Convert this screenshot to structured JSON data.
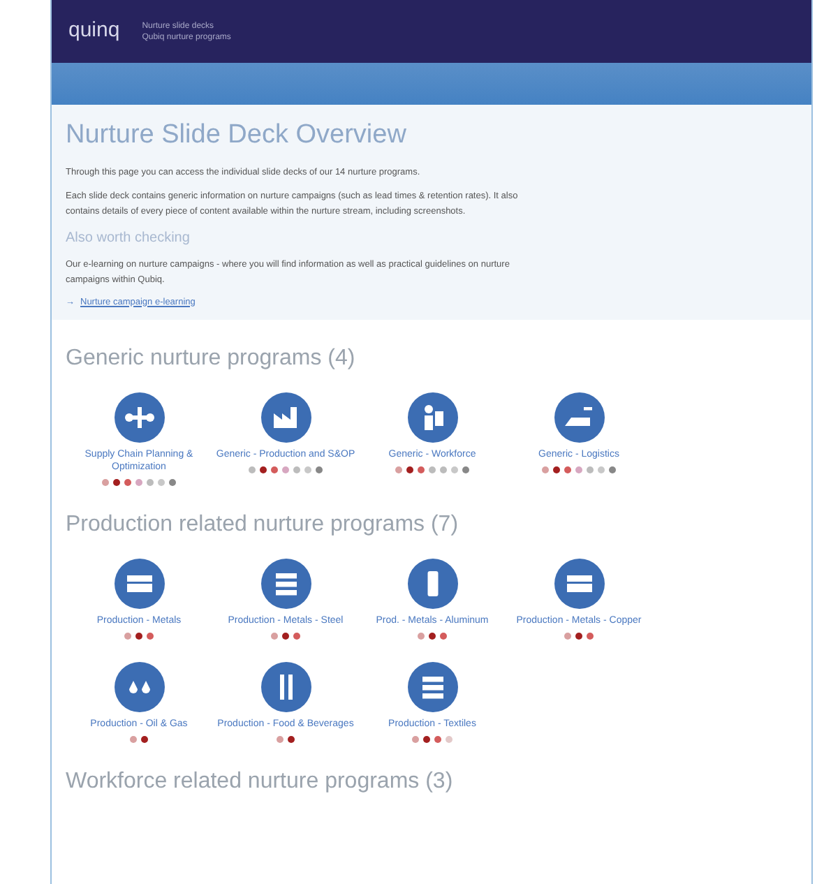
{
  "header": {
    "logo": "quinq",
    "tagline": [
      "Nurture slide decks",
      "Qubiq nurture programs"
    ]
  },
  "intro": {
    "title": "Nurture Slide Deck Overview",
    "paragraphs": [
      "Through this page you can access the individual slide decks of our 14 nurture programs.",
      "Each slide deck contains generic information on nurture campaigns (such as lead times & retention rates). It also contains details of every piece of content available within the nurture stream, including screenshots."
    ],
    "subtitle": "Also worth checking",
    "note": "Our e-learning on nurture campaigns - where you will find information as well as practical guidelines on nurture campaigns within Qubiq.",
    "link_arrow": "→",
    "link": "Nurture campaign e-learning"
  },
  "sections": [
    {
      "title": "Generic nurture programs (4)",
      "items": [
        {
          "label": "Supply Chain Planning & Optimization",
          "kind": "flow",
          "dots": [
            {
              "color": "#d9a0a0"
            },
            {
              "color": "#a31f1f"
            },
            {
              "color": "#d45c5c"
            },
            {
              "color": "#d7a7c0"
            },
            {
              "color": "#bcbcbc"
            },
            {
              "color": "#c8c8c8"
            },
            {
              "color": "#888888"
            }
          ]
        },
        {
          "label": "Generic - Production and S&OP",
          "kind": "factory",
          "dots": [
            {
              "color": "#bcbcbc"
            },
            {
              "color": "#a31f1f"
            },
            {
              "color": "#d45c5c"
            },
            {
              "color": "#d7a7c0"
            },
            {
              "color": "#bcbcbc"
            },
            {
              "color": "#c8c8c8"
            },
            {
              "color": "#888888"
            }
          ]
        },
        {
          "label": "Generic - Workforce",
          "kind": "worker",
          "dots": [
            {
              "color": "#d9a0a0"
            },
            {
              "color": "#a31f1f"
            },
            {
              "color": "#d45c5c"
            },
            {
              "color": "#bcbcbc"
            },
            {
              "color": "#bcbcbc"
            },
            {
              "color": "#c8c8c8"
            },
            {
              "color": "#888888"
            }
          ]
        },
        {
          "label": "Generic - Logistics",
          "kind": "truck",
          "dots": [
            {
              "color": "#d9a0a0"
            },
            {
              "color": "#a31f1f"
            },
            {
              "color": "#d45c5c"
            },
            {
              "color": "#d7a7c0"
            },
            {
              "color": "#bcbcbc"
            },
            {
              "color": "#c8c8c8"
            },
            {
              "color": "#888888"
            }
          ]
        }
      ]
    },
    {
      "title": "Production related nurture programs (7)",
      "items": [
        {
          "label": "Production - Metals",
          "kind": "bars",
          "dots": [
            {
              "color": "#d9a0a0"
            },
            {
              "color": "#a31f1f"
            },
            {
              "color": "#d45c5c"
            }
          ]
        },
        {
          "label": "Production - Metals - Steel",
          "kind": "stack",
          "dots": [
            {
              "color": "#d9a0a0"
            },
            {
              "color": "#a31f1f"
            },
            {
              "color": "#d45c5c"
            }
          ]
        },
        {
          "label": "Prod. - Metals - Aluminum",
          "kind": "can",
          "dots": [
            {
              "color": "#d9a0a0"
            },
            {
              "color": "#a31f1f"
            },
            {
              "color": "#d45c5c"
            }
          ]
        },
        {
          "label": "Production - Metals - Copper",
          "kind": "bars",
          "dots": [
            {
              "color": "#d9a0a0"
            },
            {
              "color": "#a31f1f"
            },
            {
              "color": "#d45c5c"
            }
          ]
        },
        {
          "label": "Production - Oil & Gas",
          "kind": "drops",
          "dots": [
            {
              "color": "#d9a0a0"
            },
            {
              "color": "#a31f1f"
            }
          ]
        },
        {
          "label": "Production - Food & Beverages",
          "kind": "cutlery",
          "dots": [
            {
              "color": "#d9a0a0"
            },
            {
              "color": "#a31f1f"
            }
          ]
        },
        {
          "label": "Production - Textiles",
          "kind": "stack",
          "dots": [
            {
              "color": "#d9a0a0"
            },
            {
              "color": "#a31f1f"
            },
            {
              "color": "#d45c5c"
            },
            {
              "color": "#e3c9c9"
            }
          ]
        }
      ]
    },
    {
      "title": "Workforce related nurture programs (3)"
    }
  ]
}
